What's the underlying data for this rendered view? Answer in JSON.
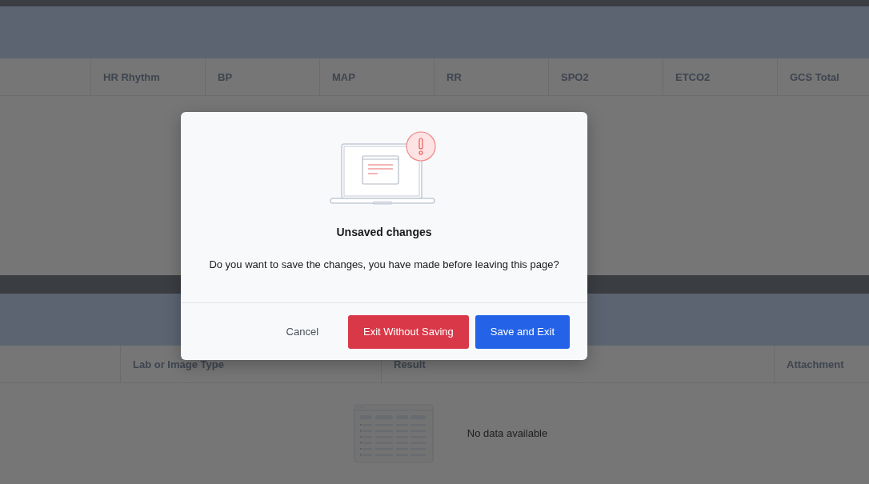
{
  "vitals_table": {
    "columns": [
      "",
      "HR Rhythm",
      "BP",
      "MAP",
      "RR",
      "SPO2",
      "ETCO2",
      "GCS Total"
    ]
  },
  "labs_table": {
    "columns": [
      "",
      "Lab or Image Type",
      "Result",
      "Attachment"
    ],
    "empty_text": "No data available"
  },
  "dialog": {
    "title": "Unsaved changes",
    "message": "Do you want to save the changes, you have made before leaving this page?",
    "buttons": [
      {
        "label": "Cancel",
        "kind": "text"
      },
      {
        "label": "Exit Without Saving",
        "kind": "danger"
      },
      {
        "label": "Save and Exit",
        "kind": "primary"
      }
    ]
  }
}
